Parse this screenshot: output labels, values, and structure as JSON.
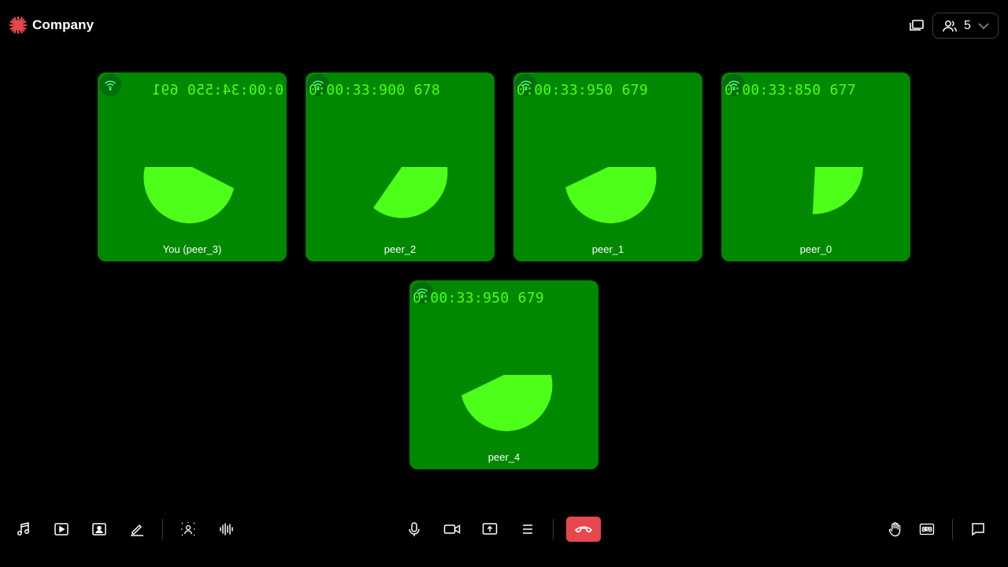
{
  "header": {
    "brand_name": "Company",
    "participants_count": "5"
  },
  "tiles": [
    {
      "name": "You (peer_3)",
      "timecode": "0:00:34:550 691",
      "mirrored": true
    },
    {
      "name": "peer_2",
      "timecode": "0:00:33:900 678",
      "mirrored": false
    },
    {
      "name": "peer_1",
      "timecode": "0:00:33:950 679",
      "mirrored": false
    },
    {
      "name": "peer_0",
      "timecode": "0:00:33:850 677",
      "mirrored": false
    },
    {
      "name": "peer_4",
      "timecode": "0:00:33:950 679",
      "mirrored": false
    }
  ],
  "toolbar": {
    "left": [
      "music-icon",
      "video-playlist-icon",
      "virtual-background-icon",
      "whiteboard-pen-icon",
      "effects-icon",
      "noise-wave-icon"
    ],
    "center": [
      "microphone-icon",
      "camera-icon",
      "screen-share-icon",
      "more-menu-icon"
    ],
    "leave": "leave-call-icon",
    "right": [
      "raise-hand-icon",
      "brb-icon",
      "chat-icon"
    ]
  },
  "colors": {
    "background": "#000000",
    "tile_bg": "#008800",
    "shape_fill": "#4dff19",
    "leave_button": "#e5484d",
    "brand_accent": "#e5484d"
  }
}
